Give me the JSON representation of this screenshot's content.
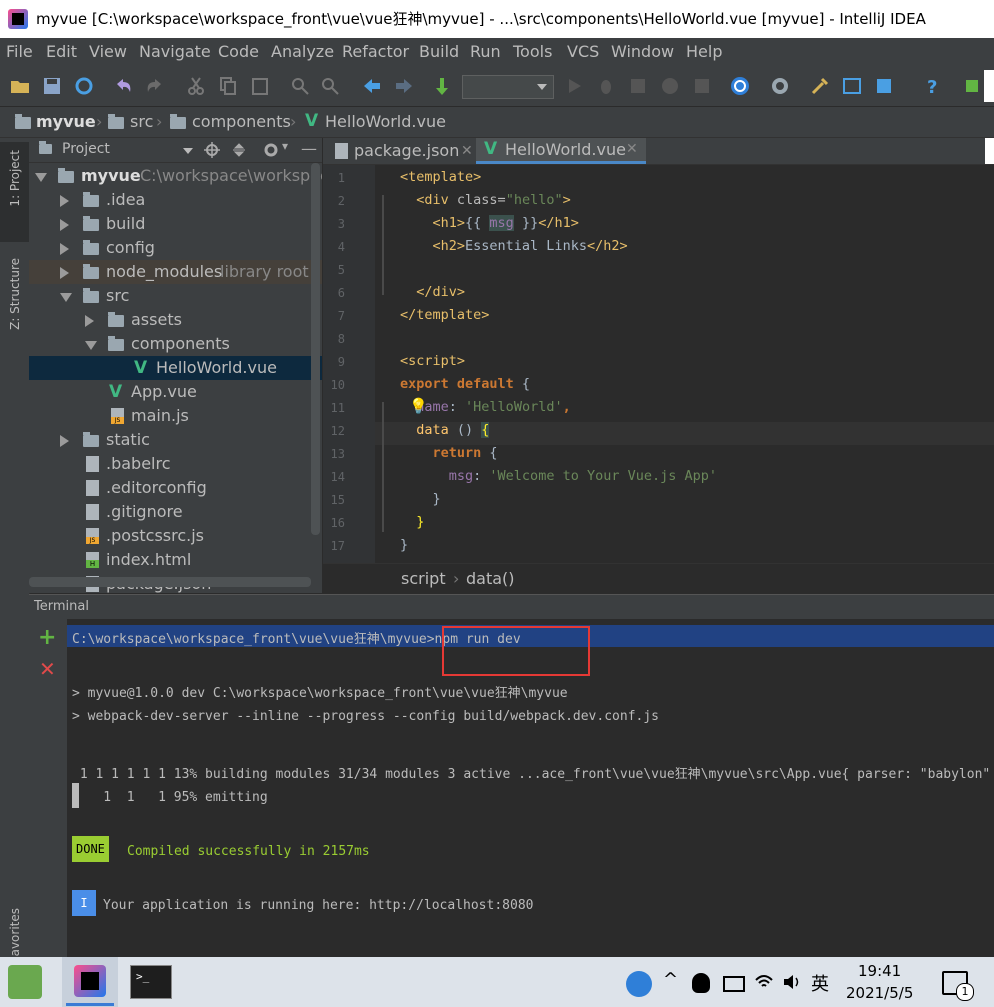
{
  "window": {
    "title": "myvue [C:\\workspace\\workspace_front\\vue\\vue狂神\\myvue] - ...\\src\\components\\HelloWorld.vue [myvue] - IntelliJ IDEA"
  },
  "menu": [
    "File",
    "Edit",
    "View",
    "Navigate",
    "Code",
    "Analyze",
    "Refactor",
    "Build",
    "Run",
    "Tools",
    "VCS",
    "Window",
    "Help"
  ],
  "breadcrumb": [
    "myvue",
    "src",
    "components",
    "HelloWorld.vue"
  ],
  "sidebar": {
    "project_label": "1: Project",
    "structure_label": "Z: Structure",
    "favorites_label": "avorites"
  },
  "project_panel": {
    "header": "Project",
    "root": {
      "name": "myvue",
      "path": "C:\\workspace\\workspace"
    },
    "items": [
      {
        "label": ".idea"
      },
      {
        "label": "build"
      },
      {
        "label": "config"
      },
      {
        "label": "node_modules",
        "note": "library root"
      },
      {
        "label": "src"
      },
      {
        "label": "assets"
      },
      {
        "label": "components"
      },
      {
        "label": "HelloWorld.vue"
      },
      {
        "label": "App.vue"
      },
      {
        "label": "main.js"
      },
      {
        "label": "static"
      },
      {
        "label": ".babelrc"
      },
      {
        "label": ".editorconfig"
      },
      {
        "label": ".gitignore"
      },
      {
        "label": ".postcssrc.js"
      },
      {
        "label": "index.html"
      },
      {
        "label": "package.json"
      }
    ]
  },
  "tabs": [
    {
      "label": "package.json"
    },
    {
      "label": "HelloWorld.vue"
    }
  ],
  "code": {
    "line_numbers": [
      "1",
      "2",
      "3",
      "4",
      "5",
      "6",
      "7",
      "8",
      "9",
      "10",
      "11",
      "12",
      "13",
      "14",
      "15",
      "16",
      "17"
    ],
    "l1": "<template>",
    "l2a": "  <div ",
    "l2b": "class=",
    "l2c": "\"hello\"",
    "l2d": ">",
    "l3a": "    <h1>",
    "l3b": "{{ ",
    "l3c": "msg",
    "l3d": " }}",
    "l3e": "</h1>",
    "l4a": "    <h2>",
    "l4b": "Essential Links",
    "l4c": "</h2>",
    "l6": "  </div>",
    "l7": "</template>",
    "l9": "<script>",
    "l10a": "export default",
    "l10b": " {",
    "l11a": "  name",
    "l11b": ": ",
    "l11c": "'HelloWorld'",
    "l11d": ",",
    "l12a": "  data ",
    "l12b": "() ",
    "l12c": "{",
    "l13a": "    return",
    "l13b": " {",
    "l14a": "      msg",
    "l14b": ": ",
    "l14c": "'Welcome to Your Vue.js App'",
    "l15": "    }",
    "l16": "  }",
    "l17": "}"
  },
  "editor_breadcrumb": [
    "script",
    "data()"
  ],
  "terminal": {
    "header": "Terminal",
    "prompt": "C:\\workspace\\workspace_front\\vue\\vue狂神\\myvue>",
    "command": "npm run dev",
    "out1": "> myvue@1.0.0 dev C:\\workspace\\workspace_front\\vue\\vue狂神\\myvue",
    "out2": "> webpack-dev-server --inline --progress --config build/webpack.dev.conf.js",
    "out3": " 1 1 1 1 1 1 13% building modules 31/34 modules 3 active ...ace_front\\vue\\vue狂神\\myvue\\src\\App.vue{ parser: \"babylon\" }",
    "out4": "    1  1   1 95% emitting",
    "done_badge": "DONE",
    "done_text": "Compiled successfully in 2157ms",
    "info_badge": "I",
    "info_text": "Your application is running here: http://localhost:8080"
  },
  "taskbar": {
    "time": "19:41",
    "date": "2021/5/5",
    "ime": "英"
  },
  "colors": {
    "vue_green": "#41b883",
    "highlight": "#214283",
    "done_bg": "#9acd32",
    "info_bg": "#4a8ee8",
    "annotation_red": "#e53935"
  }
}
